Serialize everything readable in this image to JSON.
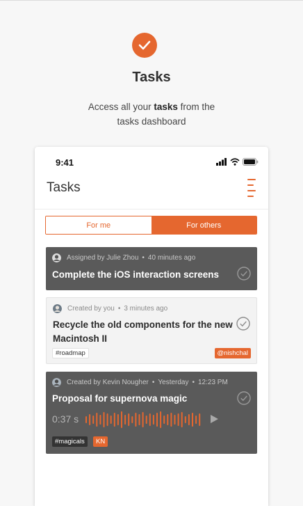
{
  "hero": {
    "title": "Tasks",
    "desc_line1_pre": "Access all your ",
    "desc_line1_bold": "tasks",
    "desc_line1_post": " from the",
    "desc_line2": "tasks dashboard",
    "accent": "#e5672f",
    "icon": "check-icon"
  },
  "status": {
    "time": "9:41"
  },
  "app": {
    "title": "Tasks",
    "menu_icon": "hamburger-icon"
  },
  "tabs": [
    {
      "label": "For me",
      "active": false
    },
    {
      "label": "For others",
      "active": true
    }
  ],
  "tasks": [
    {
      "meta_who": "Assigned by Julie Zhou",
      "meta_when": "40 minutes ago",
      "title": "Complete the iOS interaction screens",
      "theme": "dark"
    },
    {
      "meta_who": "Created by you",
      "meta_when": "3 minutes ago",
      "title_line1": "Recycle the old components for the new",
      "title_line2": "Macintosh II",
      "tag": "#roadmap",
      "assignee": "@nishchal",
      "theme": "light"
    },
    {
      "meta_who": "Created by Kevin Nougher",
      "meta_when": "Yesterday",
      "meta_time": "12:23 PM",
      "title": "Proposal for supernova magic",
      "audio_duration": "0:37 s",
      "tag": "#magicals",
      "assignee_initials": "KN",
      "theme": "dark"
    }
  ],
  "colors": {
    "accent": "#e5672f",
    "card_dark": "#5a5a5a",
    "card_light": "#f3f3f3"
  }
}
